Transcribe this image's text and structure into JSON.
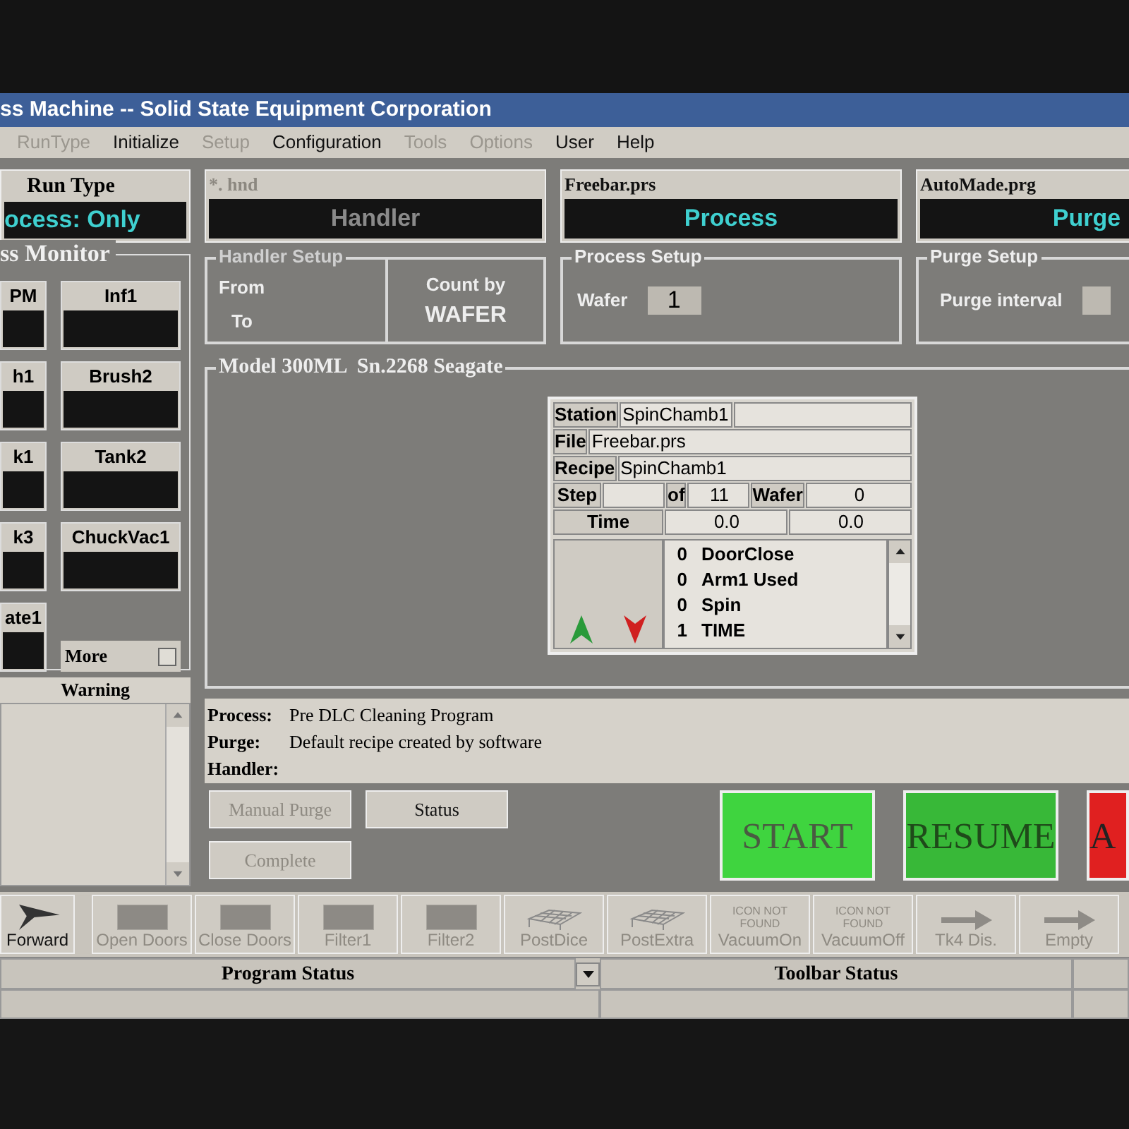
{
  "window": {
    "title": "ss Machine -- Solid State Equipment Corporation"
  },
  "menu": [
    {
      "label": "RunType",
      "disabled": true
    },
    {
      "label": "Initialize",
      "disabled": false
    },
    {
      "label": "Setup",
      "disabled": true
    },
    {
      "label": "Configuration",
      "disabled": false
    },
    {
      "label": "Tools",
      "disabled": true
    },
    {
      "label": "Options",
      "disabled": true
    },
    {
      "label": "User",
      "disabled": false
    },
    {
      "label": "Help",
      "disabled": false
    }
  ],
  "run_type": {
    "label": "Run Type",
    "value": "ocess: Only"
  },
  "mode_panels": [
    {
      "file": "*. hnd",
      "label": "Handler",
      "active": false
    },
    {
      "file": "Freebar.prs",
      "label": "Process",
      "active": true
    },
    {
      "file": "AutoMade.prg",
      "label": "Purge",
      "active": true
    }
  ],
  "handler_setup": {
    "title": "Handler Setup",
    "from_label": "From",
    "to_label": "To",
    "count_label": "Count by",
    "count_value": "WAFER"
  },
  "process_setup": {
    "title": "Process Setup",
    "wafer_label": "Wafer",
    "wafer_value": "1"
  },
  "purge_setup": {
    "title": "Purge Setup",
    "interval_label": "Purge interval"
  },
  "monitor": {
    "title": "ss Monitor",
    "items": [
      {
        "label": "PM"
      },
      {
        "label": "Inf1"
      },
      {
        "label": "h1"
      },
      {
        "label": "Brush2"
      },
      {
        "label": "k1"
      },
      {
        "label": "Tank2"
      },
      {
        "label": "k3"
      },
      {
        "label": "ChuckVac1"
      },
      {
        "label": "ate1"
      }
    ],
    "more": {
      "label": "More",
      "checked": false
    }
  },
  "warning": {
    "title": "Warning"
  },
  "station": {
    "title": "Model 300ML  Sn.2268 Seagate",
    "station_label": "Station",
    "station_value": "SpinChamb1",
    "file_label": "File",
    "file_value": "Freebar.prs",
    "recipe_label": "Recipe",
    "recipe_value": "SpinChamb1",
    "step_label": "Step",
    "of_label": "of",
    "of_value": "11",
    "wafer_label": "Wafer",
    "wafer_value": "0",
    "time_label": "Time",
    "time_values": [
      "0.0",
      "0.0"
    ],
    "steps": [
      {
        "count": "0",
        "name": "DoorClose"
      },
      {
        "count": "0",
        "name": "Arm1 Used"
      },
      {
        "count": "0",
        "name": "Spin"
      },
      {
        "count": "1",
        "name": "TIME"
      }
    ]
  },
  "info": [
    {
      "label": "Process:",
      "value": "Pre DLC Cleaning Program"
    },
    {
      "label": "Purge:",
      "value": "Default recipe created by software"
    },
    {
      "label": "Handler:"
    }
  ],
  "buttons": [
    {
      "label": "Manual Purge",
      "disabled": true
    },
    {
      "label": "Status",
      "disabled": false
    },
    {
      "label": "Complete",
      "disabled": true
    }
  ],
  "big_buttons": [
    {
      "label": "START",
      "color": "#3fd43f",
      "disabled": false
    },
    {
      "label": "RESUME",
      "color": "#38b838",
      "disabled": true
    },
    {
      "label": "A",
      "color": "#e02020",
      "disabled": false
    }
  ],
  "toolbar": [
    {
      "label": "Forward",
      "kind": "arrow",
      "disabled": false
    },
    {
      "label": "Open Doors",
      "kind": "block",
      "disabled": true
    },
    {
      "label": "Close Doors",
      "kind": "block",
      "disabled": true
    },
    {
      "label": "Filter1",
      "kind": "block",
      "disabled": true
    },
    {
      "label": "Filter2",
      "kind": "block",
      "disabled": true
    },
    {
      "label": "PostDice",
      "kind": "mesh",
      "disabled": true
    },
    {
      "label": "PostExtra",
      "kind": "mesh",
      "disabled": true
    },
    {
      "label": "VacuumOn",
      "kind": "missing",
      "icon_text": "ICON NOT FOUND",
      "disabled": true
    },
    {
      "label": "VacuumOff",
      "kind": "missing",
      "icon_text": "ICON NOT FOUND",
      "disabled": true
    },
    {
      "label": "Tk4 Dis.",
      "kind": "right-arrow",
      "disabled": true
    },
    {
      "label": "Empty",
      "kind": "right-arrow",
      "disabled": true
    }
  ],
  "status_bar": {
    "program_status": "Program Status",
    "toolbar_status": "Toolbar Status"
  }
}
